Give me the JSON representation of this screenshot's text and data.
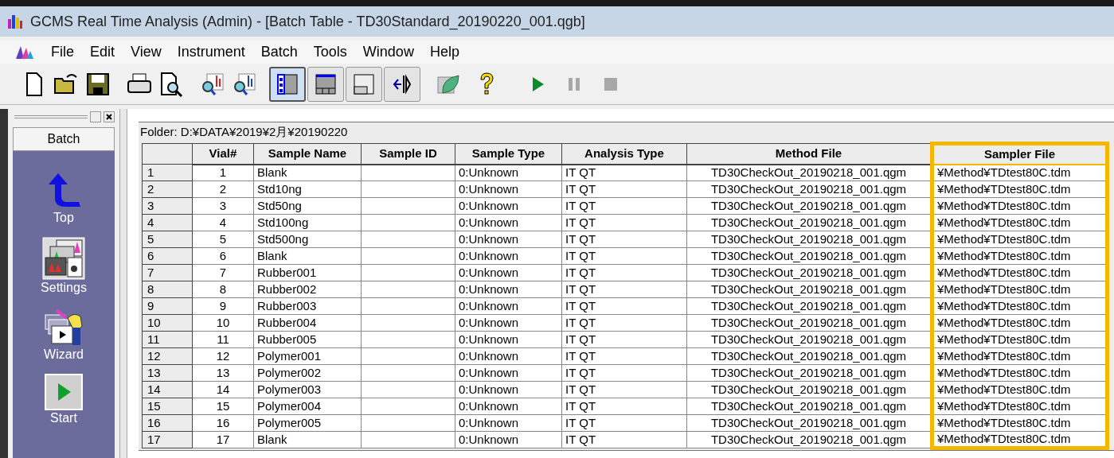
{
  "window": {
    "title": "GCMS Real Time Analysis (Admin) - [Batch Table - TD30Standard_20190220_001.qgb]"
  },
  "menu": [
    {
      "label": "File"
    },
    {
      "label": "Edit"
    },
    {
      "label": "View"
    },
    {
      "label": "Instrument"
    },
    {
      "label": "Batch"
    },
    {
      "label": "Tools"
    },
    {
      "label": "Window"
    },
    {
      "label": "Help"
    }
  ],
  "toolbar": {
    "view_buttons": [
      {
        "kind": "list",
        "selected": true
      },
      {
        "kind": "table",
        "selected": false
      },
      {
        "kind": "pane",
        "selected": false
      },
      {
        "kind": "split",
        "selected": false
      }
    ],
    "run_controls": [
      {
        "kind": "play",
        "disabled": false
      },
      {
        "kind": "pause",
        "disabled": true
      },
      {
        "kind": "stop",
        "disabled": true
      }
    ]
  },
  "sidebar": {
    "title": "Batch",
    "items": [
      {
        "kind": "top",
        "label": "Top"
      },
      {
        "kind": "settings",
        "label": "Settings"
      },
      {
        "kind": "wizard",
        "label": "Wizard"
      },
      {
        "kind": "start",
        "label": "Start"
      }
    ]
  },
  "folder": "Folder: D:¥DATA¥2019¥2月¥20190220",
  "table": {
    "columns": [
      {
        "label": "Vial#",
        "highlighted": false
      },
      {
        "label": "Sample Name",
        "highlighted": false
      },
      {
        "label": "Sample ID",
        "highlighted": false
      },
      {
        "label": "Sample Type",
        "highlighted": false
      },
      {
        "label": "Analysis Type",
        "highlighted": false
      },
      {
        "label": "Method File",
        "highlighted": false
      },
      {
        "label": "Sampler File",
        "highlighted": true
      }
    ],
    "rows": [
      {
        "index": "1",
        "cells": [
          "1",
          "Blank",
          "",
          "0:Unknown",
          "IT QT",
          "TD30CheckOut_20190218_001.qgm",
          "¥Method¥TDtest80C.tdm"
        ]
      },
      {
        "index": "2",
        "cells": [
          "2",
          "Std10ng",
          "",
          "0:Unknown",
          "IT QT",
          "TD30CheckOut_20190218_001.qgm",
          "¥Method¥TDtest80C.tdm"
        ]
      },
      {
        "index": "3",
        "cells": [
          "3",
          "Std50ng",
          "",
          "0:Unknown",
          "IT QT",
          "TD30CheckOut_20190218_001.qgm",
          "¥Method¥TDtest80C.tdm"
        ]
      },
      {
        "index": "4",
        "cells": [
          "4",
          "Std100ng",
          "",
          "0:Unknown",
          "IT QT",
          "TD30CheckOut_20190218_001.qgm",
          "¥Method¥TDtest80C.tdm"
        ]
      },
      {
        "index": "5",
        "cells": [
          "5",
          "Std500ng",
          "",
          "0:Unknown",
          "IT QT",
          "TD30CheckOut_20190218_001.qgm",
          "¥Method¥TDtest80C.tdm"
        ]
      },
      {
        "index": "6",
        "cells": [
          "6",
          "Blank",
          "",
          "0:Unknown",
          "IT QT",
          "TD30CheckOut_20190218_001.qgm",
          "¥Method¥TDtest80C.tdm"
        ]
      },
      {
        "index": "7",
        "cells": [
          "7",
          "Rubber001",
          "",
          "0:Unknown",
          "IT QT",
          "TD30CheckOut_20190218_001.qgm",
          "¥Method¥TDtest80C.tdm"
        ]
      },
      {
        "index": "8",
        "cells": [
          "8",
          "Rubber002",
          "",
          "0:Unknown",
          "IT QT",
          "TD30CheckOut_20190218_001.qgm",
          "¥Method¥TDtest80C.tdm"
        ]
      },
      {
        "index": "9",
        "cells": [
          "9",
          "Rubber003",
          "",
          "0:Unknown",
          "IT QT",
          "TD30CheckOut_20190218_001.qgm",
          "¥Method¥TDtest80C.tdm"
        ]
      },
      {
        "index": "10",
        "cells": [
          "10",
          "Rubber004",
          "",
          "0:Unknown",
          "IT QT",
          "TD30CheckOut_20190218_001.qgm",
          "¥Method¥TDtest80C.tdm"
        ]
      },
      {
        "index": "11",
        "cells": [
          "11",
          "Rubber005",
          "",
          "0:Unknown",
          "IT QT",
          "TD30CheckOut_20190218_001.qgm",
          "¥Method¥TDtest80C.tdm"
        ]
      },
      {
        "index": "12",
        "cells": [
          "12",
          "Polymer001",
          "",
          "0:Unknown",
          "IT QT",
          "TD30CheckOut_20190218_001.qgm",
          "¥Method¥TDtest80C.tdm"
        ]
      },
      {
        "index": "13",
        "cells": [
          "13",
          "Polymer002",
          "",
          "0:Unknown",
          "IT QT",
          "TD30CheckOut_20190218_001.qgm",
          "¥Method¥TDtest80C.tdm"
        ]
      },
      {
        "index": "14",
        "cells": [
          "14",
          "Polymer003",
          "",
          "0:Unknown",
          "IT QT",
          "TD30CheckOut_20190218_001.qgm",
          "¥Method¥TDtest80C.tdm"
        ]
      },
      {
        "index": "15",
        "cells": [
          "15",
          "Polymer004",
          "",
          "0:Unknown",
          "IT QT",
          "TD30CheckOut_20190218_001.qgm",
          "¥Method¥TDtest80C.tdm"
        ]
      },
      {
        "index": "16",
        "cells": [
          "16",
          "Polymer005",
          "",
          "0:Unknown",
          "IT QT",
          "TD30CheckOut_20190218_001.qgm",
          "¥Method¥TDtest80C.tdm"
        ]
      },
      {
        "index": "17",
        "cells": [
          "17",
          "Blank",
          "",
          "0:Unknown",
          "IT QT",
          "TD30CheckOut_20190218_001.qgm",
          "¥Method¥TDtest80C.tdm"
        ]
      }
    ]
  }
}
